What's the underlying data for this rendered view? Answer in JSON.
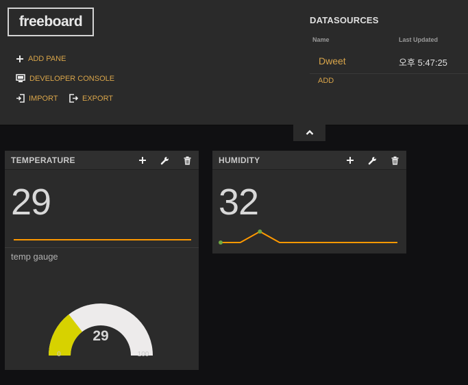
{
  "header": {
    "logo": "freeboard",
    "actions": {
      "add_pane": "ADD PANE",
      "developer_console": "DEVELOPER CONSOLE",
      "import": "IMPORT",
      "export": "EXPORT"
    }
  },
  "datasources": {
    "title": "DATASOURCES",
    "columns": {
      "name": "Name",
      "last_updated": "Last Updated"
    },
    "rows": [
      {
        "name": "Dweet",
        "last_updated": "오후 5:47:25"
      }
    ],
    "add_label": "ADD"
  },
  "panes": [
    {
      "title": "TEMPERATURE",
      "value": "29",
      "sparkline": [
        29,
        29,
        29,
        29,
        29,
        29,
        29
      ],
      "gauge": {
        "title": "temp gauge",
        "value": "29",
        "min": "0",
        "max": "100",
        "fraction": 0.29
      }
    },
    {
      "title": "HUMIDITY",
      "value": "32",
      "sparkline": [
        32,
        32,
        35,
        32,
        32,
        32,
        32,
        32,
        32,
        32
      ]
    }
  ],
  "colors": {
    "accent": "#d9a54a",
    "sparkline": "#ff9900",
    "gauge_fill": "#d7d200",
    "gauge_track": "#edebeb"
  },
  "icons": [
    "plus-icon",
    "monitor-icon",
    "import-icon",
    "export-icon",
    "chevron-up-icon",
    "wrench-icon",
    "trash-icon"
  ]
}
